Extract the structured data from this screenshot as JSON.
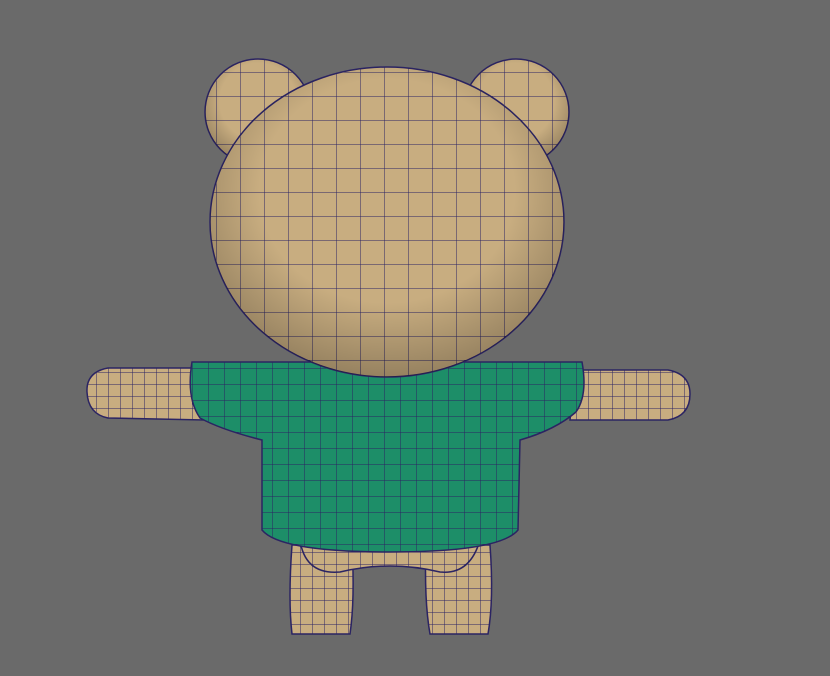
{
  "viewport": {
    "background_color": "#6a6a6a",
    "model": {
      "skin_color": "#c8ad80",
      "shirt_color": "#1d8e68",
      "wire_color": "#2b2463"
    }
  }
}
